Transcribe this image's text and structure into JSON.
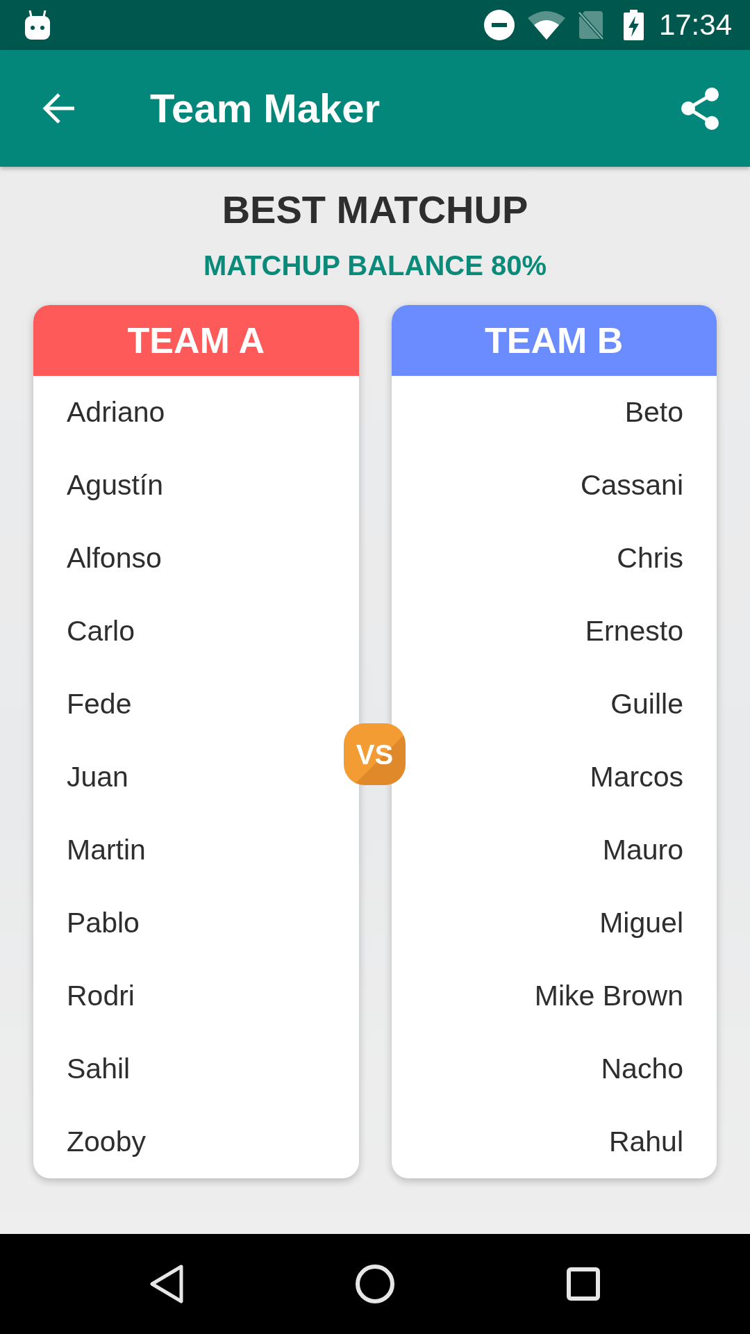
{
  "status_bar": {
    "time": "17:34"
  },
  "app_bar": {
    "title": "Team Maker"
  },
  "header": {
    "title": "BEST MATCHUP",
    "subtitle": "MATCHUP BALANCE 80%"
  },
  "teams": [
    {
      "name": "TEAM A",
      "color": "#ff5a5a",
      "players": [
        "Adriano",
        "Agustín",
        "Alfonso",
        "Carlo",
        "Fede",
        "Juan",
        "Martin",
        "Pablo",
        "Rodri",
        "Sahil",
        "Zooby"
      ]
    },
    {
      "name": "TEAM B",
      "color": "#6a8cff",
      "players": [
        "Beto",
        "Cassani",
        "Chris",
        "Ernesto",
        "Guille",
        "Marcos",
        "Mauro",
        "Miguel",
        "Mike Brown",
        "Nacho",
        "Rahul"
      ]
    }
  ],
  "vs_badge": {
    "label": "VS"
  }
}
